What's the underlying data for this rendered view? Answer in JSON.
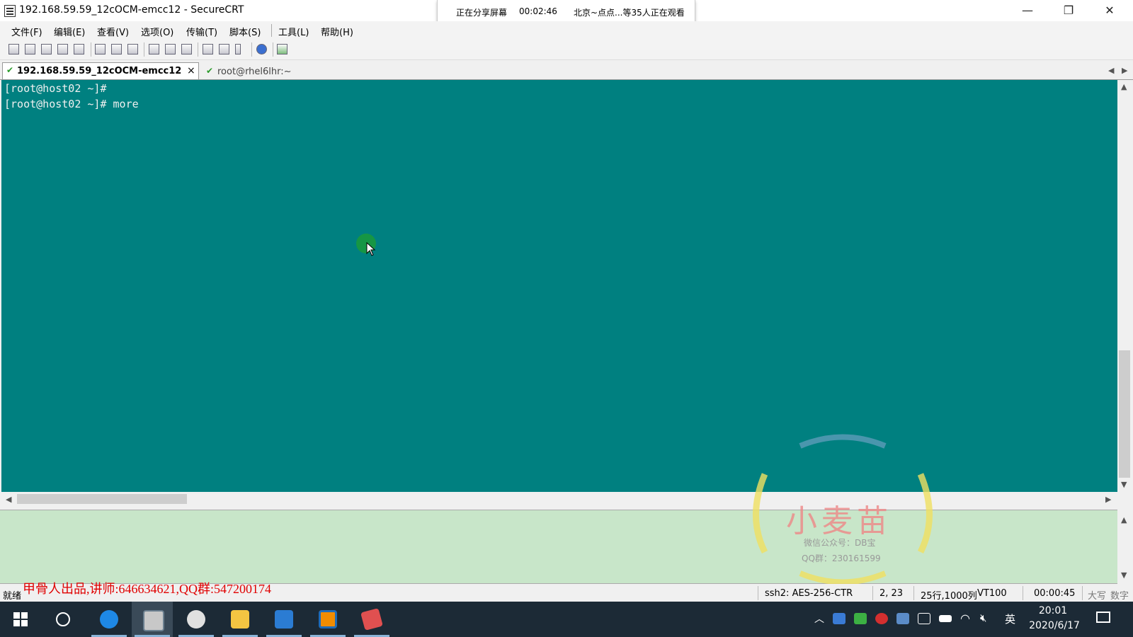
{
  "window": {
    "title": "192.168.59.59_12cOCM-emcc12 - SecureCRT",
    "minimize": "—",
    "restore": "❐",
    "close": "✕"
  },
  "share_banner": {
    "status": "正在分享屏幕",
    "timer": "00:02:46",
    "viewers": "北京~点点...等35人正在观看"
  },
  "menu": [
    "文件(F)",
    "编辑(E)",
    "查看(V)",
    "选项(O)",
    "传输(T)",
    "脚本(S)",
    "工具(L)",
    "帮助(H)"
  ],
  "tabs": [
    {
      "label": "192.168.59.59_12cOCM-emcc12",
      "close": "×",
      "active": true
    },
    {
      "label": "root@rhel6lhr:~",
      "active": false
    }
  ],
  "terminal": {
    "lines": [
      "[root@host02 ~]#",
      "[root@host02 ~]# more"
    ],
    "bg_color": "#008080"
  },
  "status_bar": {
    "ready": "就绪",
    "cipher": "ssh2: AES-256-CTR",
    "cursor_pos": "2,  23",
    "size": "25行,1000列",
    "terminal_type": "VT100",
    "session_time": "00:00:45",
    "caps": "大写",
    "num": "数字"
  },
  "overlay_caption": "甲骨人出品,讲师:646634621,QQ群:547200174",
  "watermark": {
    "brand": "小麦苗",
    "line1": "微信公众号：DB宝",
    "line2": "QQ群：230161599"
  },
  "taskbar": {
    "ime": "英",
    "time": "20:01",
    "date": "2020/6/17"
  }
}
